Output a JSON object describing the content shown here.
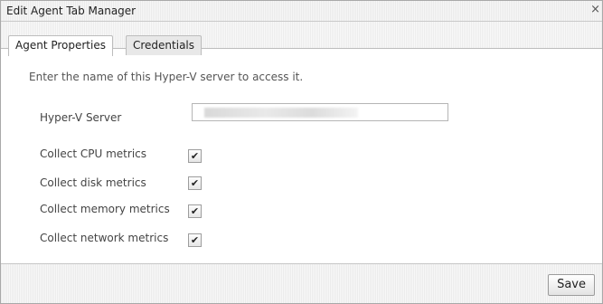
{
  "window": {
    "title": "Edit Agent Tab Manager",
    "close_glyph": "×"
  },
  "tabs": [
    {
      "label": "Agent Properties",
      "active": true
    },
    {
      "label": "Credentials",
      "active": false
    }
  ],
  "form": {
    "intro": "Enter the name of this Hyper-V server to access it.",
    "server_label": "Hyper-V Server",
    "checkboxes": [
      {
        "label": "Collect CPU metrics",
        "checked": true
      },
      {
        "label": "Collect disk metrics",
        "checked": true
      },
      {
        "label": "Collect memory metrics",
        "checked": true
      },
      {
        "label": "Collect network metrics",
        "checked": true
      }
    ]
  },
  "footer": {
    "save_label": "Save"
  }
}
